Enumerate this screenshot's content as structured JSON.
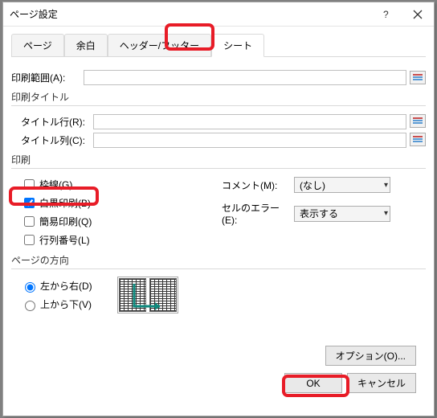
{
  "title": "ページ設定",
  "tabs": {
    "page": "ページ",
    "margins": "余白",
    "headerfooter": "ヘッダー/フッター",
    "sheet": "シート"
  },
  "labels": {
    "print_area": "印刷範囲(A):",
    "print_titles": "印刷タイトル",
    "title_rows": "タイトル行(R):",
    "title_cols": "タイトル列(C):",
    "print_section": "印刷",
    "gridlines": "枠線(G)",
    "bw": "白黒印刷(B)",
    "draft": "簡易印刷(Q)",
    "rowcol": "行列番号(L)",
    "comments": "コメント(M):",
    "cellerr": "セルのエラー(E):",
    "pageorder": "ページの方向",
    "ltr": "左から右(D)",
    "ttb": "上から下(V)"
  },
  "combo": {
    "comments_val": "(なし)",
    "cellerr_val": "表示する"
  },
  "buttons": {
    "options": "オプション(O)...",
    "ok": "OK",
    "cancel": "キャンセル"
  }
}
